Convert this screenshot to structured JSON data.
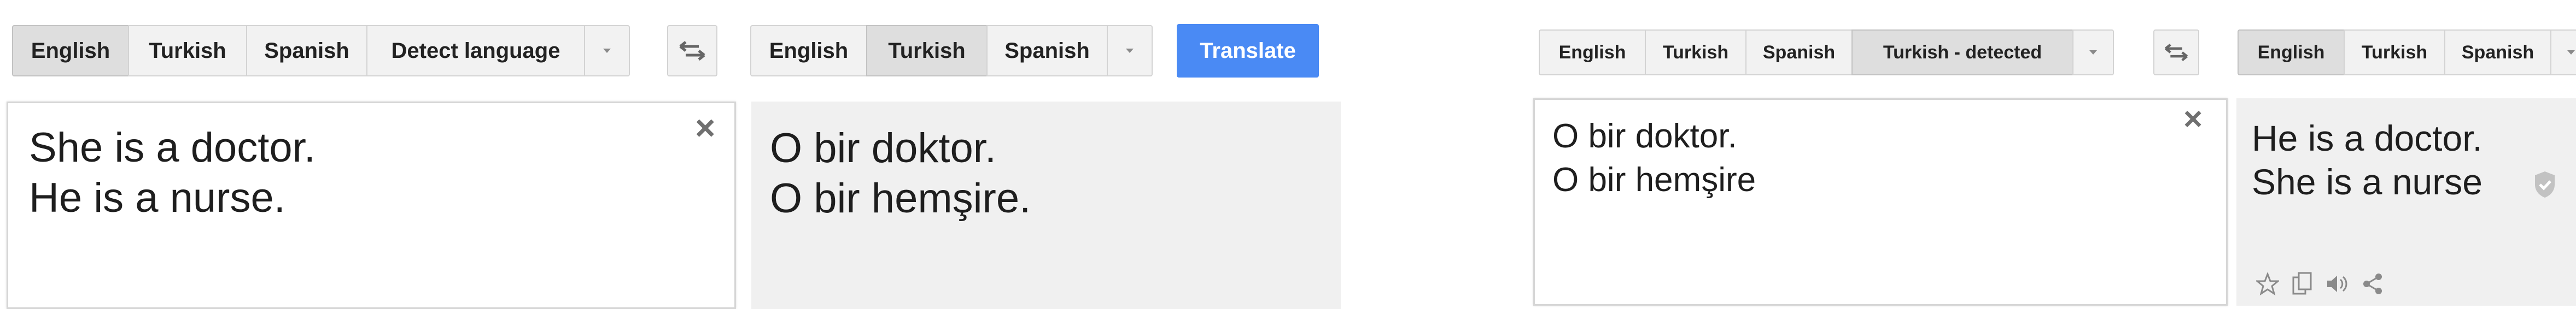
{
  "left": {
    "source_langs": [
      "English",
      "Turkish",
      "Spanish",
      "Detect language"
    ],
    "source_selected": "English",
    "target_langs": [
      "English",
      "Turkish",
      "Spanish"
    ],
    "target_selected": "Turkish",
    "translate_label": "Translate",
    "source_lines": [
      "She is a doctor.",
      "He is a nurse."
    ],
    "target_lines": [
      "O bir doktor.",
      "O bir hemşire."
    ],
    "close_glyph": "×"
  },
  "right": {
    "source_langs": [
      "English",
      "Turkish",
      "Spanish",
      "Turkish - detected"
    ],
    "source_selected": "Turkish - detected",
    "target_langs": [
      "English",
      "Turkish",
      "Spanish"
    ],
    "target_selected": "English",
    "source_lines": [
      "O bir doktor.",
      "O bir hemşire"
    ],
    "target_lines": [
      "He is a doctor.",
      "She is a nurse"
    ],
    "close_glyph": "×"
  },
  "icons": {
    "swap": "swap-arrows-icon",
    "dropdown": "caret-down-icon",
    "close": "close-icon",
    "verified": "shield-check-icon",
    "star": "star-icon",
    "copy": "copy-icon",
    "speaker": "speaker-icon",
    "share": "share-icon"
  },
  "colors": {
    "translate_button": "#4a8af4",
    "tab_background": "#f2f2f2",
    "tab_active": "#dedede",
    "target_background": "#f0f0f0"
  }
}
